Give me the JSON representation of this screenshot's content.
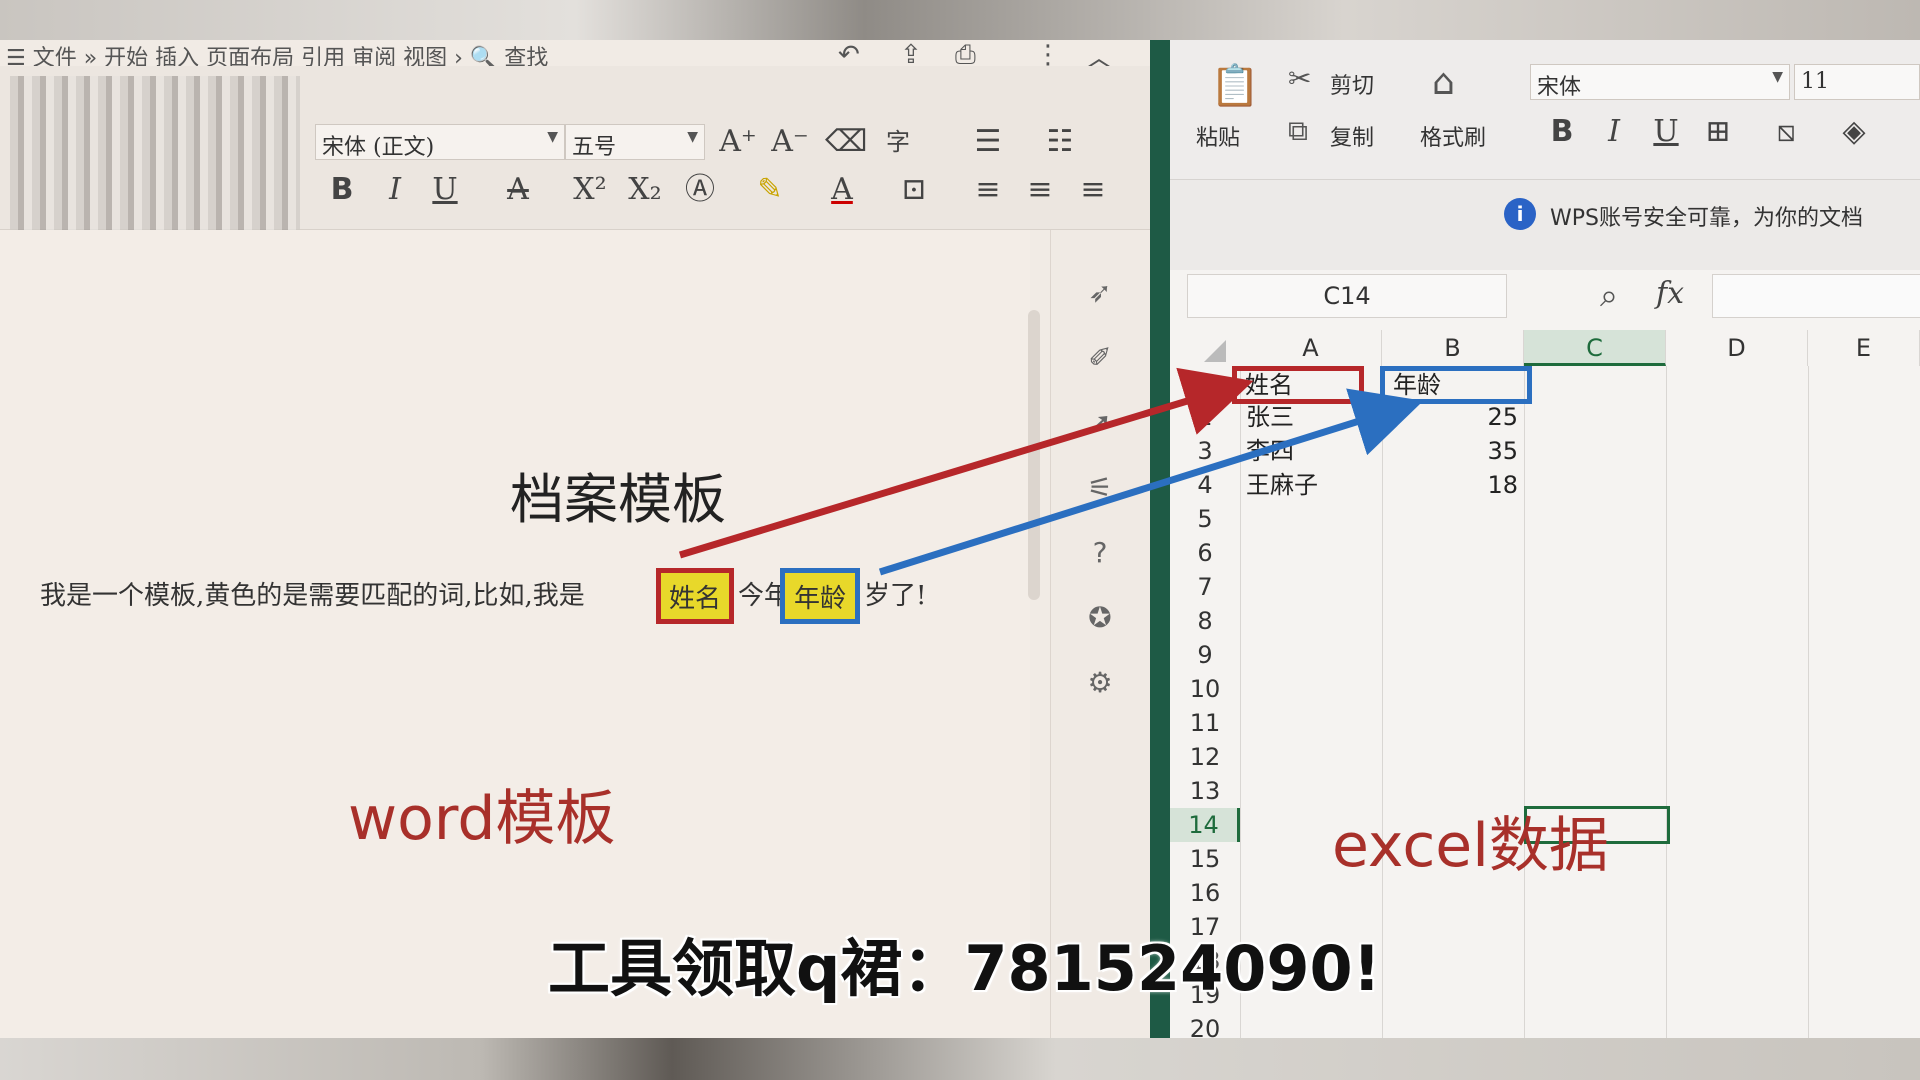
{
  "word": {
    "menu": "☰ 文件  »  开始 插入 页面布局 引用 审阅 视图  ›   🔍 查找",
    "font_name": "宋体 (正文)",
    "font_size": "五号",
    "doc_title": "档案模板",
    "sentence_prefix": "我是一个模板,黄色的是需要匹配的词,比如,我是",
    "field_name": "姓名",
    "sentence_mid": "今年",
    "field_age": "年龄",
    "sentence_suffix": "岁了!",
    "overlay_label": "word模板"
  },
  "excel": {
    "paste": "粘贴",
    "cut": "剪切",
    "copy": "复制",
    "format_painter": "格式刷",
    "font_name": "宋体",
    "font_size": "11",
    "notice": "WPS账号安全可靠，为你的文档",
    "name_box": "C14",
    "fx": "fx",
    "columns": [
      "A",
      "B",
      "C",
      "D",
      "E"
    ],
    "rows": [
      "1",
      "2",
      "3",
      "4",
      "5",
      "6",
      "7",
      "8",
      "9",
      "10",
      "11",
      "12",
      "13",
      "14",
      "15",
      "16",
      "17",
      "18",
      "19",
      "20"
    ],
    "header_name": "姓名",
    "header_age": "年龄",
    "data": [
      {
        "name": "张三",
        "age": "25"
      },
      {
        "name": "李四",
        "age": "35"
      },
      {
        "name": "王麻子",
        "age": "18"
      }
    ],
    "overlay_label": "excel数据",
    "selected_column": "C",
    "selected_row": "14"
  },
  "subtitle": "工具领取q裙：781524090!",
  "colors": {
    "red_box": "#b6272a",
    "blue_box": "#2b6fc0",
    "highlight": "#e8d82a",
    "divider": "#1e5a45"
  }
}
